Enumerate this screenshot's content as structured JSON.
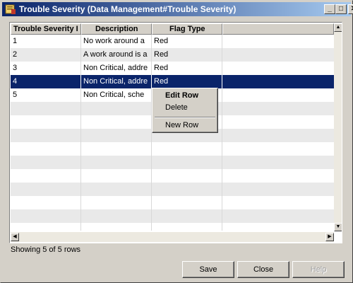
{
  "window": {
    "title": "Trouble Severity (Data Management#Trouble Severity)",
    "minimize_glyph": "_",
    "maximize_glyph": "□",
    "close_glyph": "✕"
  },
  "table": {
    "columns": [
      "Trouble Severity I",
      "Description",
      "Flag Type"
    ],
    "rows": [
      {
        "id": "1",
        "description": "No work around a",
        "flag": "Red"
      },
      {
        "id": "2",
        "description": "A work around is a",
        "flag": "Red"
      },
      {
        "id": "3",
        "description": "Non  Critical, addre",
        "flag": "Red"
      },
      {
        "id": "4",
        "description": "Non  Critical, addre",
        "flag": "Red"
      },
      {
        "id": "5",
        "description": "Non  Critical, sche",
        "flag": ""
      }
    ],
    "selected_row": "4"
  },
  "context_menu": {
    "edit_row": "Edit Row",
    "delete": "Delete",
    "new_row": "New Row"
  },
  "status": "Showing 5 of 5 rows",
  "buttons": {
    "save": "Save",
    "close": "Close",
    "help": "Help"
  },
  "scroll": {
    "up": "▲",
    "down": "▼",
    "left": "◀",
    "right": "▶"
  },
  "colors": {
    "selection": "#0a246a",
    "title_start": "#0a246a",
    "title_end": "#a6caf0"
  }
}
